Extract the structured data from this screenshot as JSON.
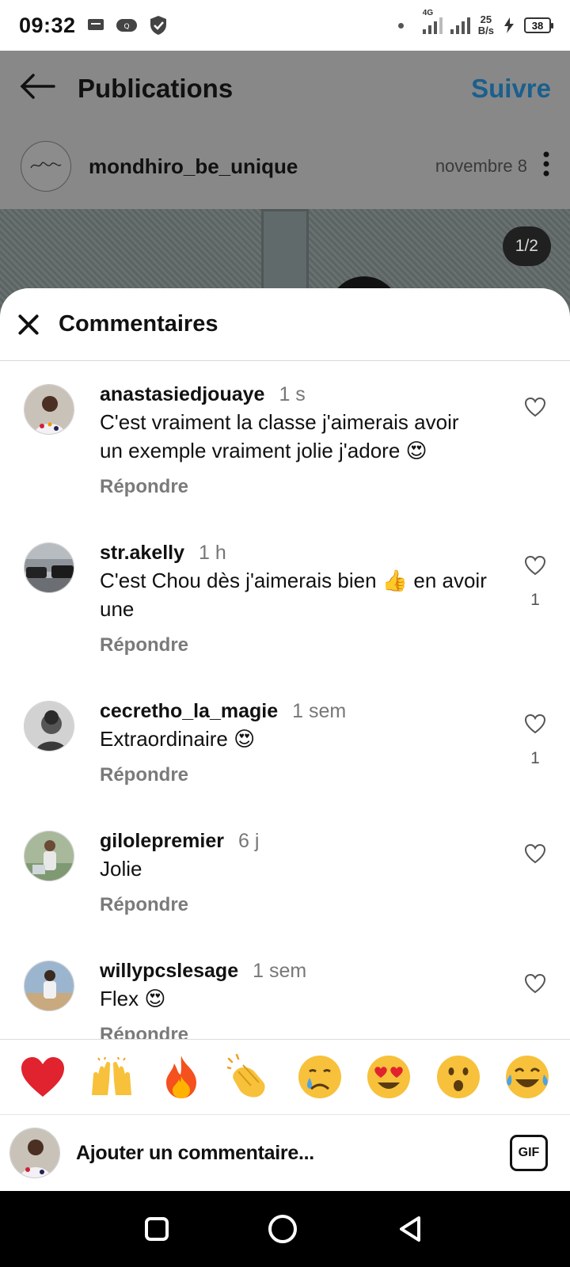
{
  "status_bar": {
    "time": "09:32",
    "network": "4G",
    "speed_value": "25",
    "speed_unit": "B/s",
    "battery": "38"
  },
  "background": {
    "title": "Publications",
    "follow_label": "Suivre",
    "post_user": "mondhiro_be_unique",
    "post_date": "novembre 8",
    "image_counter": "1/2"
  },
  "sheet": {
    "title": "Commentaires"
  },
  "comments": [
    {
      "user": "anastasiedjouaye",
      "time": "1 s",
      "lines": [
        "C'est vraiment la classe j'aimerais avoir",
        "un exemple vraiment jolie j'adore 😍"
      ],
      "reply": "Répondre",
      "likes": ""
    },
    {
      "user": "str.akelly",
      "time": "1 h",
      "lines": [
        "C'est Chou dès j'aimerais bien 👍 en avoir",
        "une"
      ],
      "reply": "Répondre",
      "likes": "1"
    },
    {
      "user": "cecretho_la_magie",
      "time": "1 sem",
      "lines": [
        "Extraordinaire 😍"
      ],
      "reply": "Répondre",
      "likes": "1"
    },
    {
      "user": "gilolepremier",
      "time": "6 j",
      "lines": [
        "Jolie"
      ],
      "reply": "Répondre",
      "likes": ""
    },
    {
      "user": "willypcslesage",
      "time": "1 sem",
      "lines": [
        "Flex 😍"
      ],
      "reply": "Répondre",
      "likes": ""
    }
  ],
  "emoji_bar": [
    "red-heart",
    "raising-hands",
    "fire",
    "clapping-hands",
    "crying-face",
    "heart-eyes",
    "astonished-face",
    "tears-of-joy"
  ],
  "input": {
    "placeholder": "Ajouter un commentaire...",
    "gif_label": "GIF"
  },
  "colors": {
    "accent": "#1a5f8e",
    "like_heart": "#e0232e"
  }
}
